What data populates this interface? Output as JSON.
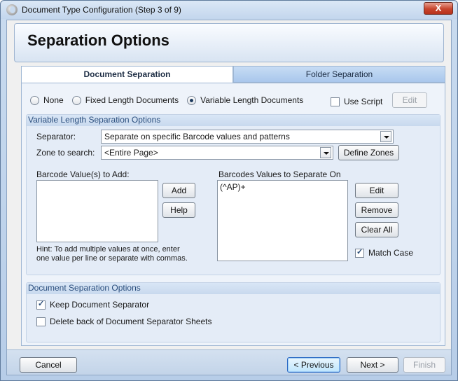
{
  "window": {
    "title": "Document Type Configuration (Step 3 of 9)",
    "close_glyph": "X"
  },
  "header": {
    "title": "Separation Options"
  },
  "tabs": [
    {
      "label": "Document Separation",
      "active": true
    },
    {
      "label": "Folder Separation",
      "active": false
    }
  ],
  "mode": {
    "options": [
      {
        "label": "None",
        "selected": false
      },
      {
        "label": "Fixed Length Documents",
        "selected": false
      },
      {
        "label": "Variable Length Documents",
        "selected": true
      }
    ],
    "use_script_label": "Use Script",
    "use_script_checked": false,
    "edit_label": "Edit"
  },
  "variable_group": {
    "title": "Variable Length Separation Options",
    "separator_label": "Separator:",
    "separator_value": "Separate on specific Barcode values and patterns",
    "zone_label": "Zone to search:",
    "zone_value": "<Entire Page>",
    "define_zones_label": "Define Zones",
    "barcode_add_label": "Barcode Value(s) to Add:",
    "add_label": "Add",
    "help_label": "Help",
    "separate_on_label": "Barcodes Values to Separate On",
    "separate_on_items": [
      "(^AP)+"
    ],
    "edit_label": "Edit",
    "remove_label": "Remove",
    "clear_all_label": "Clear All",
    "match_case_label": "Match Case",
    "match_case_checked": true,
    "hint_line1": "Hint: To add multiple values at once, enter",
    "hint_line2": "one value per line or separate with commas."
  },
  "doc_sep_group": {
    "title": "Document Separation Options",
    "keep_label": "Keep Document Separator",
    "keep_checked": true,
    "delete_back_label": "Delete back of Document Separator Sheets",
    "delete_back_checked": false
  },
  "footer": {
    "cancel_label": "Cancel",
    "previous_label": "< Previous",
    "next_label": "Next >",
    "finish_label": "Finish"
  },
  "colors": {
    "accent": "#2a4e7d",
    "tab_inactive": "#a9c7ec",
    "close": "#c7452d"
  }
}
